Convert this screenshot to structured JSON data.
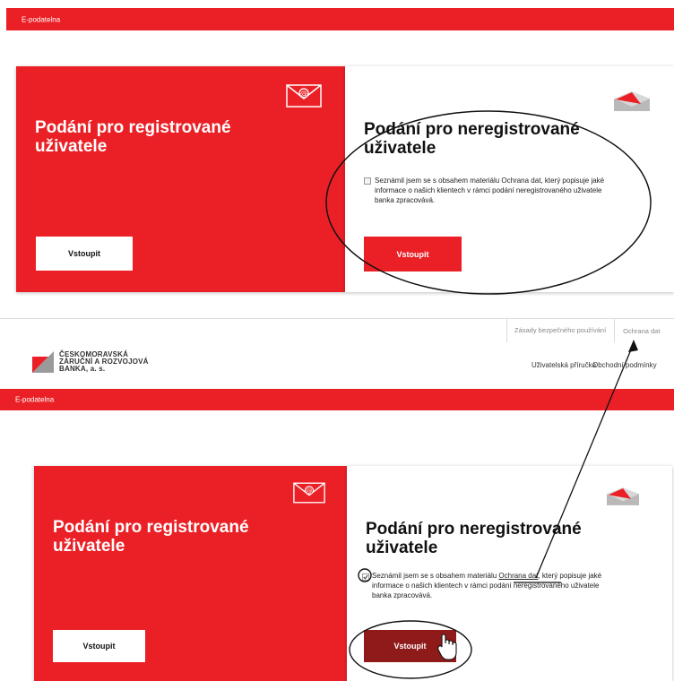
{
  "top_section": {
    "header_bar_label": "E-podatelna",
    "left_card": {
      "title_line1": "Podání pro registrované",
      "title_line2": "uživatele",
      "button_label": "Vstoupit",
      "icon": "envelope-at-icon"
    },
    "right_card": {
      "title_line1": "Podání pro neregistrované",
      "title_line2": "uživatele",
      "consent_line1": "Seznámil jsem se s obsahem materiálu Ochrana dat, který popisuje jaké",
      "consent_line2": "informace o našich klientech v rámci podání neregistrovaného uživatele",
      "consent_line3": "banka zpracovává.",
      "button_label": "Vstoupit",
      "icon": "envelope-open-icon"
    }
  },
  "bottom_section": {
    "top_links": {
      "security": "Zásady bezpečného používání",
      "data_protection": "Ochrana dat"
    },
    "logo": {
      "line1": "ČESKOMORAVSKÁ",
      "line2": "ZÁRUČNÍ A ROZVOJOVÁ",
      "line3": "BANKA, a. s."
    },
    "nav": {
      "manual": "Uživatelská příručka",
      "terms": "Obchodní podmínky"
    },
    "header_bar_label": "E-podatelna",
    "left_card": {
      "title_line1": "Podání pro registrované",
      "title_line2": "uživatele",
      "button_label": "Vstoupit",
      "icon": "envelope-at-icon"
    },
    "right_card": {
      "title_line1": "Podání pro neregistrované",
      "title_line2": "uživatele",
      "consent_pre": "Seznámil jsem se s obsahem materiálu ",
      "consent_link": "Ochrana dat",
      "consent_post": ", který popisuje jaké",
      "consent_line2": "informace o našich klientech v rámci podání neregistrovaného uživatele",
      "consent_line3": "banka zpracovává.",
      "button_label": "Vstoupit",
      "checkbox_checked": true,
      "icon": "envelope-open-icon"
    }
  },
  "colors": {
    "brand_red": "#ea2026",
    "button_pressed": "#8f1a1a"
  }
}
